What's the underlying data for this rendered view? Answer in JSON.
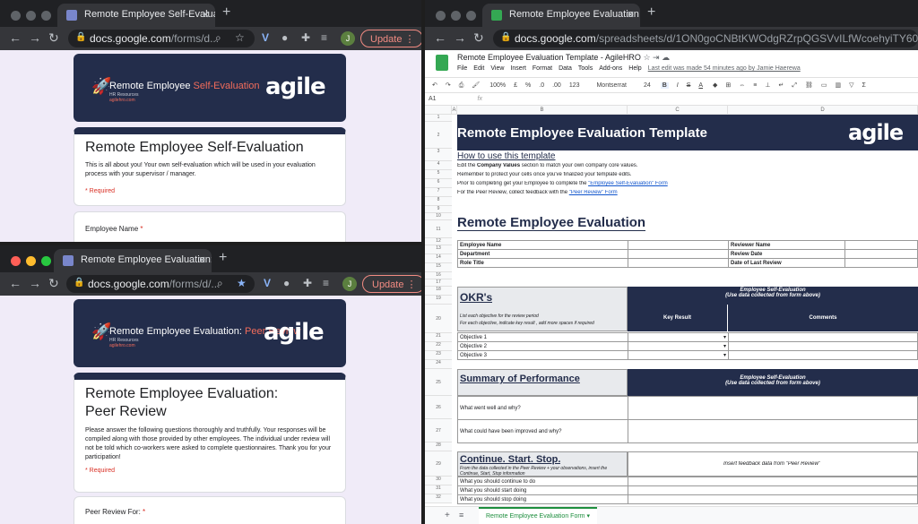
{
  "colors": {
    "navy": "#232d4b",
    "coral": "#f26c5b",
    "sheets_green": "#34a853",
    "update_red": "#f28b82"
  },
  "form1": {
    "tab_title": "Remote Employee Self-Evaluat",
    "url_host": "docs.google.com",
    "url_path": "/forms/d...",
    "update_label": "Update",
    "avatar_initial": "J",
    "banner_title_a": "Remote Employee ",
    "banner_title_b": "Self-Evaluation",
    "banner_sub": "HR Resources",
    "banner_sub2": "agilehro.com",
    "logo": "agile",
    "title": "Remote Employee Self-Evaluation",
    "description": "This is all about you! Your own self-evaluation which will be used in your evaluation process with your supervisor / manager.",
    "required_note": "* Required",
    "question1": "Employee Name",
    "question1_star": "*"
  },
  "form2": {
    "tab_title": "Remote Employee Evaluation: F",
    "url_host": "docs.google.com",
    "url_path": "/forms/d/...",
    "update_label": "Update",
    "avatar_initial": "J",
    "banner_title_a": "Remote Employee Evaluation: ",
    "banner_title_b": "Peer Review",
    "banner_sub": "HR Resources",
    "banner_sub2": "agilehro.com",
    "logo": "agile",
    "title": "Remote Employee Evaluation: Peer Review",
    "description": "Please answer the following questions thoroughly and truthfully. Your responses will be compiled along with those provided by other employees. The individual under review will not be told which co-workers were asked to complete questionnaires. Thank you for your participation!",
    "required_note": "* Required",
    "question1": "Peer Review For:",
    "question1_star": "*"
  },
  "sheet": {
    "tab_title": "Remote Employee Evaluation T",
    "url_host": "docs.google.com",
    "url_path": "/spreadsheets/d/1ON0goCNBtKWOdgRZrpQGSVvILfWcoehyiTY603QCRgM/ed",
    "doc_title": "Remote Employee Evaluation Template - AgileHRO",
    "menu": [
      "File",
      "Edit",
      "View",
      "Insert",
      "Format",
      "Data",
      "Tools",
      "Add-ons",
      "Help"
    ],
    "last_edit": "Last edit was made 54 minutes ago by Jamie Haerewa",
    "toolbar": {
      "zoom": "100%",
      "currency": "£",
      "percent": "%",
      "dec0": ".0",
      "dec2": ".00",
      "numfmt": "123",
      "font": "Montserrat",
      "size": "24",
      "bold": "B",
      "italic": "I",
      "strike": "S",
      "textcolor": "A"
    },
    "cell_ref": "A1",
    "fx": "fx",
    "col_headers": [
      "A",
      "B",
      "C",
      "D"
    ],
    "row_numbers": [
      "1",
      "2",
      "3",
      "4",
      "5",
      "6",
      "7",
      "8",
      "9",
      "10",
      "11",
      "12",
      "13",
      "14",
      "15",
      "16",
      "17",
      "18",
      "19",
      "20",
      "21",
      "22",
      "23",
      "24",
      "25",
      "26",
      "27",
      "28",
      "29",
      "30",
      "31",
      "32"
    ],
    "header_title": "Remote Employee Evaluation Template",
    "logo": "agile",
    "how_to": "How to use this template",
    "instr1_a": "Edit the ",
    "instr1_b": "Company Values",
    "instr1_c": " section to match your own company core values.",
    "instr2": "Remember to protect your cells once you've finalized your template edits.",
    "instr3_a": "Prior to completing get your Employee to complete the ",
    "instr3_link": "\"Employee Self-Evaluation\" Form",
    "instr4_a": "For the Peer Review, collect feedback with the ",
    "instr4_link": "\"Peer Review\" Form",
    "section_title": "Remote Employee Evaluation",
    "info_left": [
      "Employee Name",
      "Department",
      "Role Title"
    ],
    "info_right": [
      "Reviewer Name",
      "Review Date",
      "Date of Last Review"
    ],
    "okr_title": "OKR's",
    "okr_note": "List each objective for the review period\nFor each objective, indicate key result , add more spaces if required",
    "self_eval_head": "Employee Self-Evaluation\n(Use data collected from form above)",
    "key_result": "Key Result",
    "comments": "Comments",
    "objectives": [
      "Objective 1",
      "Objective 2",
      "Objective 3"
    ],
    "perf_title": "Summary of Performance",
    "perf_head": "Employee Self-Evaluation\n(Use data collected from form above)",
    "perf_q1": "What went well and why?",
    "perf_q2": "What could have been improved and why?",
    "css_title": "Continue. Start. Stop.",
    "css_note": "From the data collected in the Peer Review + your observations, insert the Continue, Start, Stop information",
    "css_insert": "Insert feedback data from \"Peer Review\"",
    "css_rows": [
      "What you should continue to do",
      "What you should start doing",
      "What you should stop doing"
    ],
    "sheet_tab": "Remote Employee Evaluation Form"
  }
}
